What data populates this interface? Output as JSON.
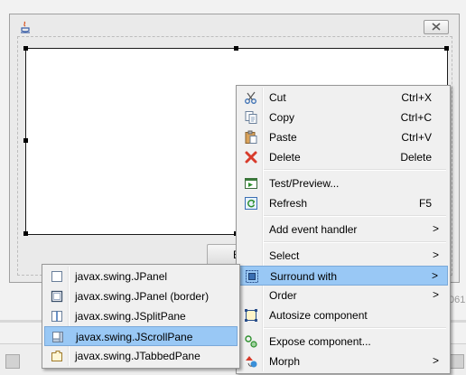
{
  "background": {
    "partial_number": "061"
  },
  "form": {
    "partial_button_label": "E"
  },
  "context_menu": {
    "cut": {
      "label": "Cut",
      "shortcut": "Ctrl+X"
    },
    "copy": {
      "label": "Copy",
      "shortcut": "Ctrl+C"
    },
    "paste": {
      "label": "Paste",
      "shortcut": "Ctrl+V"
    },
    "delete": {
      "label": "Delete",
      "shortcut": "Delete"
    },
    "test_preview": {
      "label": "Test/Preview..."
    },
    "refresh": {
      "label": "Refresh",
      "shortcut": "F5"
    },
    "add_event_handler": {
      "label": "Add event handler",
      "arrow": ">"
    },
    "select": {
      "label": "Select",
      "arrow": ">"
    },
    "surround_with": {
      "label": "Surround with",
      "arrow": ">"
    },
    "order": {
      "label": "Order",
      "arrow": ">"
    },
    "autosize": {
      "label": "Autosize component"
    },
    "expose": {
      "label": "Expose component..."
    },
    "morph": {
      "label": "Morph",
      "arrow": ">"
    }
  },
  "surround_submenu": {
    "items": [
      {
        "label": "javax.swing.JPanel",
        "icon": "panel-icon"
      },
      {
        "label": "javax.swing.JPanel (border)",
        "icon": "panel-border-icon"
      },
      {
        "label": "javax.swing.JSplitPane",
        "icon": "split-pane-icon"
      },
      {
        "label": "javax.swing.JScrollPane",
        "icon": "scroll-pane-icon"
      },
      {
        "label": "javax.swing.JTabbedPane",
        "icon": "tabbed-pane-icon"
      }
    ]
  },
  "colors": {
    "highlight": "#99c8f5",
    "menu_bg": "#f0f0f0",
    "delete_red": "#d83b2b"
  }
}
